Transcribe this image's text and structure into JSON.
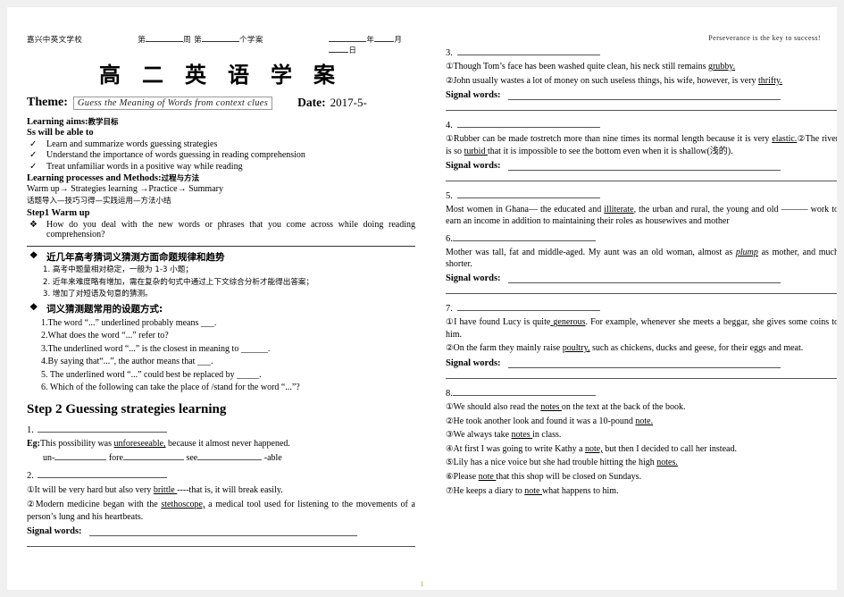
{
  "page": {
    "number": "1",
    "motto": "Perseverance is the key to success!"
  },
  "header": {
    "school": "嘉兴中英文学校",
    "week_prefix": "第",
    "week_mid": "周 第",
    "week_suffix": "个学案",
    "date_year": "年",
    "date_month": "月",
    "date_day": "日",
    "title": "高 二 英 语 学 案"
  },
  "theme": {
    "label": "Theme:",
    "value": "Guess the Meaning of Words from context clues",
    "date_label": "Date:",
    "date_value": "2017-5-"
  },
  "aims": {
    "heading": "Learning aims:",
    "heading_cn": "教学目标",
    "subheading": "Ss will be able to",
    "items": [
      "Learn and summarize words guessing strategies",
      "Understand the importance of words guessing in reading comprehension",
      "Treat unfamiliar words in a positive way while reading"
    ]
  },
  "processes": {
    "heading": "Learning processes and Methods:",
    "heading_cn": "过程与方法",
    "flow_en": "Warm up→ Strategies learning →Practice→ Summary",
    "flow_cn": "话题导入—技巧习得—实践运用—方法小结"
  },
  "step1": {
    "heading": "Step1 Warm up",
    "question": "How do you deal with the new words or phrases that you come across while doing reading comprehension?"
  },
  "trends": {
    "heading_cn": "近几年高考猜词义猜测方面命题规律和趋势",
    "items": [
      "1. 高考中题量相对稳定，一般为 1-3 小题；",
      "2. 近年来难度略有增加，需在复杂的句式中通过上下文综合分析才能得出答案；",
      "3. 增加了对短语及句意的猜测。"
    ],
    "q_heading_cn": "词义猜测题常用的设题方式:",
    "questions": [
      "1.The word “...” underlined probably means ___.",
      "2.What does the word “...” refer to?",
      "3.The underlined word “...” is the closest in meaning to ______.",
      "4.By saying that“...”, the author means that ___.",
      "5. The underlined word “...” could best be replaced by _____.",
      "6. Which of the following can take the place of /stand for the word “...”?"
    ]
  },
  "step2": {
    "heading": "Step 2 Guessing strategies learning"
  },
  "strategies": [
    {
      "num": "1.",
      "eg_label": "Eg:",
      "eg_text_pre": "This possibility was ",
      "eg_underlined": "unforeseeable,",
      "eg_text_post": " because it almost never happened.",
      "prefix_parts": [
        "un-",
        "fore",
        "see",
        "-able"
      ]
    },
    {
      "num": "2.",
      "sentences": [
        {
          "mark": "①",
          "pre": "It will be very hard but also very ",
          "ul": "brittle ",
          "post": "----that is, it will break easily."
        },
        {
          "mark": "②",
          "pre": "Modern medicine began with the ",
          "ul": "stethoscope,",
          "post": " a medical tool used for listening to the movements of a person’s lung and his heartbeats."
        }
      ],
      "signal_label": "Signal words:"
    },
    {
      "num": "3.",
      "sentences": [
        {
          "mark": "①",
          "pre": "Though Tom’s face has been washed quite clean,  his neck still remains ",
          "ul": "grubby.",
          "post": ""
        },
        {
          "mark": "②",
          "pre": "John usually wastes a lot of money on such useless things, his wife, however, is very ",
          "ul": "thrifty.",
          "post": ""
        }
      ],
      "signal_label": "Signal words:"
    },
    {
      "num": "4.",
      "sentences": [
        {
          "mark": "①",
          "pre": "Rubber can be made tostretch more than nine times its normal length because it is very ",
          "ul": "elastic.",
          "post": ""
        },
        {
          "mark": "②",
          "pre": "The river is so ",
          "ul": "turbid ",
          "post": "that it is impossible to see the bottom even when it is shallow(浅的)."
        }
      ],
      "signal_label": "Signal words:"
    },
    {
      "num": "5.",
      "body_pre": "Most women in Ghana— the educated and ",
      "body_ul": "illiterate",
      "body_post": ", the urban and rural, the young and old ——— work to earn an income in addition to maintaining their roles as housewives and mother"
    },
    {
      "num": "6.",
      "body_pre": "Mother was tall, fat and middle-aged. My aunt was an old woman, almost as ",
      "body_ul": "plump",
      "body_post": " as mother, and much shorter.",
      "signal_label": "Signal words:"
    },
    {
      "num": "7.",
      "sentences": [
        {
          "mark": "①",
          "pre": "I have found Lucy is quite",
          "ul": " generous",
          "post": ". For example, whenever she meets a beggar, she gives some coins to him."
        },
        {
          "mark": "②",
          "pre": "On the farm they mainly raise ",
          "ul": "poultry,",
          "post": " such as chickens, ducks and geese, for their eggs and meat."
        }
      ],
      "signal_label": "Signal words:"
    },
    {
      "num": "8.",
      "sentences": [
        {
          "mark": "①",
          "pre": "We should also read the ",
          "ul": "notes ",
          "post": "on the text at the back of the book."
        },
        {
          "mark": "②",
          "pre": "He took another look and found it was a 10-pound ",
          "ul": "note.",
          "post": ""
        },
        {
          "mark": "③",
          "pre": "We always take ",
          "ul": "notes ",
          "post": "in class."
        },
        {
          "mark": "④",
          "pre": "At first I was going to write Kathy a ",
          "ul": "note,",
          "post": " but then I decided to call her instead."
        },
        {
          "mark": "⑤",
          "pre": "Lily has a nice voice but she had trouble hitting the high ",
          "ul": "notes.",
          "post": ""
        },
        {
          "mark": "⑥",
          "pre": "Please ",
          "ul": "note ",
          "post": "that this shop will be closed on Sundays."
        },
        {
          "mark": "⑦",
          "pre": "He keeps a diary to ",
          "ul": "note ",
          "post": "what happens to him."
        }
      ]
    }
  ]
}
